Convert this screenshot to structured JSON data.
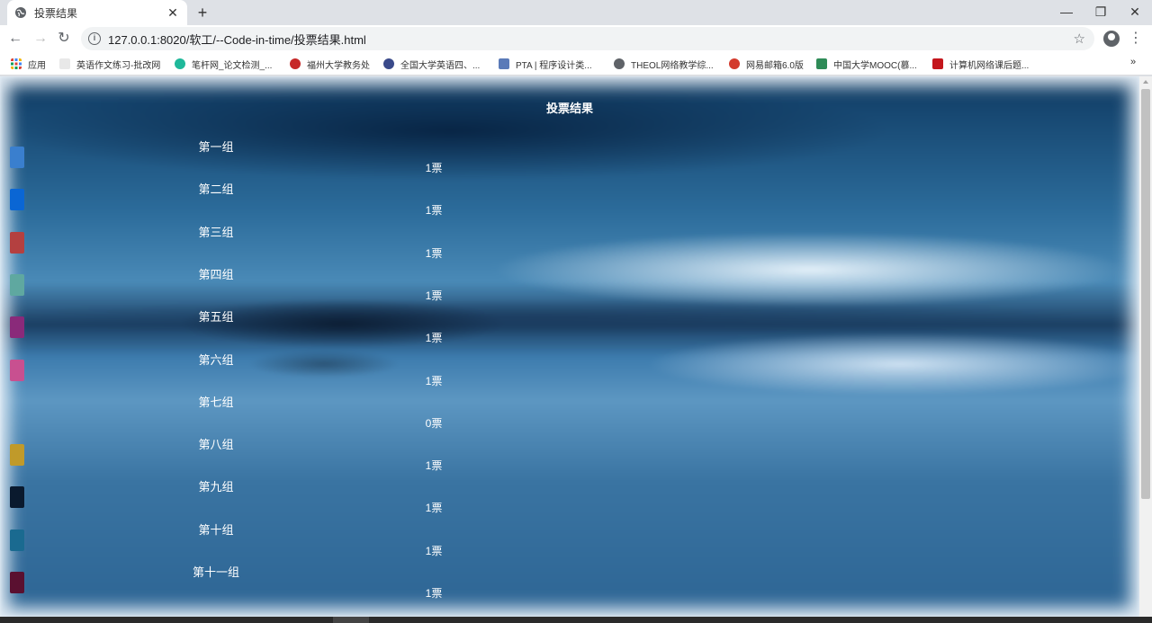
{
  "browser": {
    "tab_title": "投票结果",
    "tab_close": "✕",
    "new_tab": "+",
    "url": "127.0.0.1:8020/软工/--Code-in-time/投票结果.html",
    "minimize": "—",
    "restore": "❐",
    "close": "✕"
  },
  "bookmarks": {
    "apps": "应用",
    "items": [
      "英语作文练习-批改网",
      "笔杆网_论文检测_...",
      "福州大学教务处",
      "全国大学英语四、...",
      "PTA | 程序设计类...",
      "THEOL网络教学综...",
      "网易邮箱6.0版",
      "中国大学MOOC(慕...",
      "计算机网络课后题..."
    ],
    "more": "»"
  },
  "page": {
    "title": "投票结果",
    "groups": [
      {
        "name": "第一组",
        "votes": "1票",
        "color": "#3a7fce"
      },
      {
        "name": "第二组",
        "votes": "1票",
        "color": "#0a66d4"
      },
      {
        "name": "第三组",
        "votes": "1票",
        "color": "#b44040"
      },
      {
        "name": "第四组",
        "votes": "1票",
        "color": "#5fa8a0"
      },
      {
        "name": "第五组",
        "votes": "1票",
        "color": "#8a2a7a"
      },
      {
        "name": "第六组",
        "votes": "1票",
        "color": "#c85090"
      },
      {
        "name": "第七组",
        "votes": "0票",
        "color": ""
      },
      {
        "name": "第八组",
        "votes": "1票",
        "color": "#c09a2a"
      },
      {
        "name": "第九组",
        "votes": "1票",
        "color": "#0a1a2e"
      },
      {
        "name": "第十组",
        "votes": "1票",
        "color": "#1a6a90"
      },
      {
        "name": "第十一组",
        "votes": "1票",
        "color": "#5a1030"
      }
    ]
  }
}
